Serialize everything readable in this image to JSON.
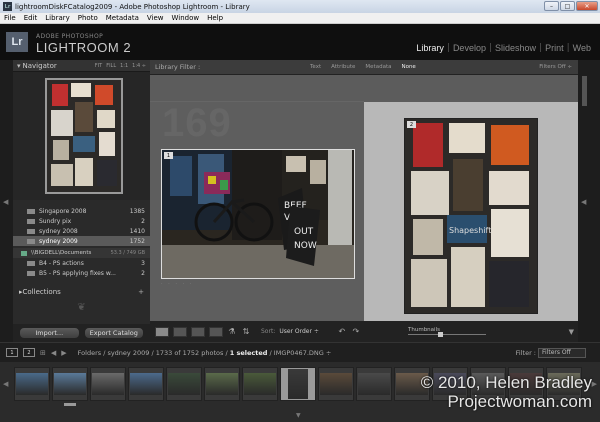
{
  "window": {
    "title": "lightroomDiskFCatalog2009 - Adobe Photoshop Lightroom - Library",
    "minimize": "–",
    "maximize": "□",
    "close": "✕"
  },
  "menu": [
    "File",
    "Edit",
    "Library",
    "Photo",
    "Metadata",
    "View",
    "Window",
    "Help"
  ],
  "header": {
    "logo": "Lr",
    "brand_top": "ADOBE PHOTOSHOP",
    "brand_name": "LIGHTROOM 2",
    "modules": [
      "Library",
      "Develop",
      "Slideshow",
      "Print",
      "Web"
    ],
    "active_module": "Library"
  },
  "navigator": {
    "title": "Navigator",
    "zooms": [
      "FIT",
      "FILL",
      "1:1",
      "1:4 ÷"
    ]
  },
  "folders": [
    {
      "name": "Singapore 2008",
      "count": "1385"
    },
    {
      "name": "Sundry pix",
      "count": "2"
    },
    {
      "name": "sydney 2008",
      "count": "1410"
    },
    {
      "name": "sydney 2009",
      "count": "1752",
      "selected": true
    }
  ],
  "drive": {
    "name": "\\\\BIGDELL\\Documents",
    "size": "53.3 / 749 GB"
  },
  "subfolders": [
    {
      "name": "B4 - PS actions",
      "count": "3"
    },
    {
      "name": "B5 - PS applying fixes w...",
      "count": "2"
    }
  ],
  "collections": {
    "label": "Collections",
    "plus": "+"
  },
  "left_buttons": {
    "import": "Import...",
    "export": "Export Catalog"
  },
  "filter_bar": {
    "label": "Library Filter :",
    "options": [
      "Text",
      "Attribute",
      "Metadata",
      "None"
    ],
    "active_option": "None",
    "filters_off": "Filters Off ÷"
  },
  "compare": {
    "left_number": "169",
    "left_badge": "1",
    "right_badge": "2"
  },
  "toolbar": {
    "sort_label": "Sort:",
    "sort_value": "User Order ÷",
    "thumbnails_label": "Thumbnails"
  },
  "filmstrip_bar": {
    "view1": "1",
    "view2": "2",
    "path_prefix": "Folders / sydney 2009 / 1733 of 1752 photos /",
    "selected": "1 selected",
    "file": "/ IMGP0467.DNG ÷",
    "filter_label": "Filter :",
    "filter_value": "Filters Off"
  },
  "filmstrip": {
    "thumb_colors": [
      "#4a6a8a",
      "#5a7a9a",
      "#6a6a6a",
      "#4c6a8c",
      "#3a4a3a",
      "#5a6a4a",
      "#4a5a3a",
      "#3a3a3a",
      "#5a4a3a",
      "#4a4a4a",
      "#6a5a4a",
      "#4a4a5a",
      "#5a5a5a",
      "#4a3a3a",
      "#6a6a5a"
    ],
    "selected_index": 7
  },
  "watermark": {
    "line1": "© 2010, Helen Bradley",
    "line2": "Projectwoman.com"
  }
}
